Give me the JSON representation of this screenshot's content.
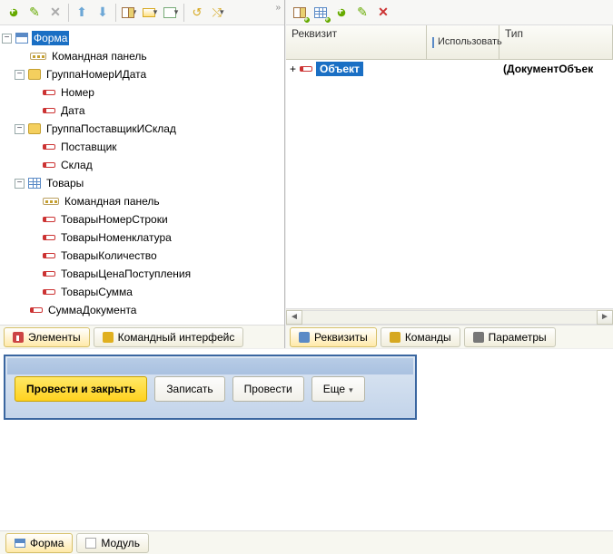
{
  "left": {
    "tree": {
      "root": "Форма",
      "items": [
        {
          "icon": "cmdbar",
          "label": "Командная панель"
        },
        {
          "icon": "folder",
          "label": "ГруппаНомерИДата",
          "expanded": true,
          "children": [
            {
              "icon": "attr",
              "label": "Номер"
            },
            {
              "icon": "attr",
              "label": "Дата"
            }
          ]
        },
        {
          "icon": "folder",
          "label": "ГруппаПоставщикИСклад",
          "expanded": true,
          "children": [
            {
              "icon": "attr",
              "label": "Поставщик"
            },
            {
              "icon": "attr",
              "label": "Склад"
            }
          ]
        },
        {
          "icon": "table",
          "label": "Товары",
          "expanded": true,
          "children": [
            {
              "icon": "cmdbar",
              "label": "Командная панель"
            },
            {
              "icon": "attr",
              "label": "ТоварыНомерСтроки"
            },
            {
              "icon": "attr",
              "label": "ТоварыНоменклатура"
            },
            {
              "icon": "attr",
              "label": "ТоварыКоличество"
            },
            {
              "icon": "attr",
              "label": "ТоварыЦенаПоступления"
            },
            {
              "icon": "attr",
              "label": "ТоварыСумма"
            }
          ]
        },
        {
          "icon": "attr",
          "label": "СуммаДокумента"
        }
      ]
    },
    "tabs": {
      "elements": "Элементы",
      "cmdiface": "Командный интерфейс"
    }
  },
  "right": {
    "headers": {
      "attr": "Реквизит",
      "use": "Использовать",
      "type": "Тип"
    },
    "row": {
      "name": "Объект",
      "type": "(ДокументОбъек"
    },
    "tabs": {
      "attrs": "Реквизиты",
      "cmds": "Команды",
      "params": "Параметры"
    }
  },
  "preview": {
    "post_close": "Провести и закрыть",
    "write": "Записать",
    "post": "Провести",
    "more": "Еще"
  },
  "bottom": {
    "form": "Форма",
    "module": "Модуль"
  }
}
